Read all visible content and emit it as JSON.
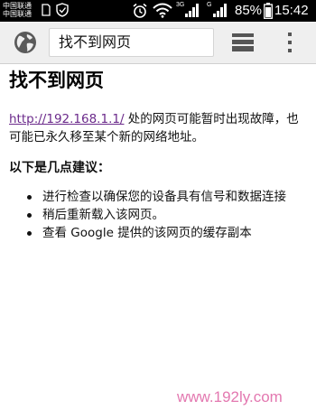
{
  "status_bar": {
    "carrier_1": "中国联通",
    "carrier_2": "中国联通",
    "network_label_1": "3G",
    "network_label_2": "G",
    "battery": "85%",
    "time": "15:42",
    "icons": [
      "sim-icon",
      "shield-icon",
      "alarm-icon",
      "wifi-icon",
      "signal-icon",
      "battery-icon"
    ]
  },
  "toolbar": {
    "omnibox_text": "找不到网页",
    "icons": [
      "globe-icon",
      "tabs-icon",
      "overflow-menu-icon"
    ]
  },
  "page": {
    "title": "找不到网页",
    "link": "http://192.168.1.1/",
    "message": " 处的网页可能暂时出现故障，也可能已永久移至某个新的网络地址。",
    "suggestions_title": "以下是几点建议：",
    "suggestions": [
      "进行检查以确保您的设备具有信号和数据连接",
      "稍后重新载入该网页。",
      "查看 Google 提供的该网页的缓存副本"
    ]
  },
  "watermark": "www.192ly.com",
  "colors": {
    "status_bar_bg": "#000000",
    "toolbar_bg": "#efefef",
    "link": "#6b2a8b",
    "watermark": "#e06aa8"
  }
}
